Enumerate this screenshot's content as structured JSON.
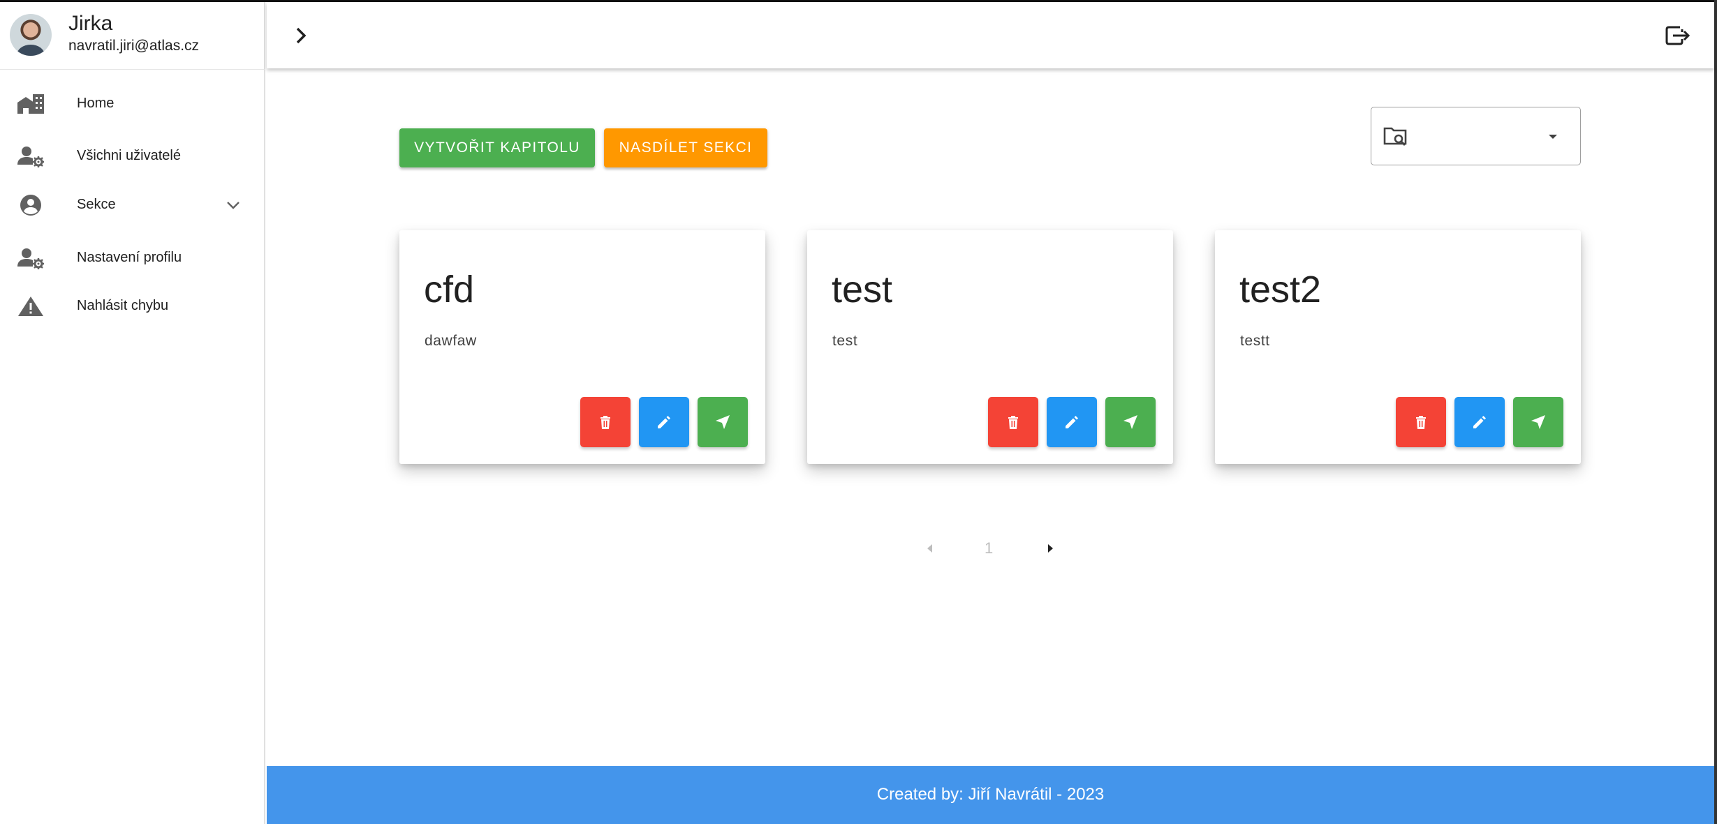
{
  "profile": {
    "name": "Jirka",
    "email": "navratil.jiri@atlas.cz"
  },
  "sidebar": {
    "items": [
      {
        "label": "Home",
        "icon": "home-building-icon"
      },
      {
        "label": "Všichni uživatelé",
        "icon": "user-gear-icon"
      },
      {
        "label": "Sekce",
        "icon": "account-circle-icon",
        "expandable": true
      },
      {
        "label": "Nastavení profilu",
        "icon": "user-gear-icon"
      },
      {
        "label": "Nahlásit chybu",
        "icon": "warning-icon"
      }
    ]
  },
  "toolbar": {
    "create_label": "VYTVOŘIT KAPITOLU",
    "share_label": "NASDÍLET SEKCI",
    "section_select_value": ""
  },
  "cards": [
    {
      "title": "cfd",
      "description": "dawfaw"
    },
    {
      "title": "test",
      "description": "test"
    },
    {
      "title": "test2",
      "description": "testt"
    }
  ],
  "pagination": {
    "current_page": "1"
  },
  "footer": {
    "text": "Created by: Jiří Navrátil - 2023"
  },
  "colors": {
    "create": "#4caf50",
    "share": "#ff9800",
    "delete": "#f44336",
    "edit": "#2196f3",
    "send": "#4caf50",
    "footer": "#4495eb"
  }
}
